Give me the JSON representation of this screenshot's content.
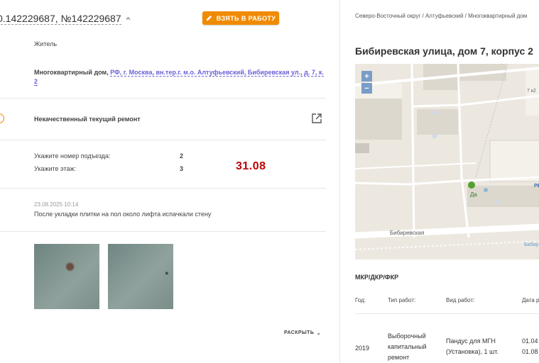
{
  "header": {
    "title": "0.142229687, №142229687",
    "chevron": "⌃",
    "take_button": "ВЗЯТЬ В РАБОТУ",
    "pencil_icon": "pencil-icon"
  },
  "applicant": {
    "role": "Житель"
  },
  "address": {
    "prefix": "Многоквартирный дом,",
    "link": "РФ, г. Москва, вн.тер.г. м.о. Алтуфьевский, Бибиревская ул., д. 7, к.",
    "link2": "2"
  },
  "category": {
    "name": "Некачественный текущий ремонт"
  },
  "fields": [
    {
      "label": "Укажите номер подъезда:",
      "value": "2"
    },
    {
      "label": "Укажите этаж:",
      "value": "3"
    }
  ],
  "annotation": "31.08",
  "comment": {
    "date": "23.08.2025 10:14",
    "text": "После укладки плитки на пол около лифта испачкали стену"
  },
  "expand_label": "РАСКРЫТЬ",
  "right": {
    "breadcrumb": "Северо-Восточный округ / Алтуфьевский / Многоквартирный дом",
    "address_title": "Бибиревская улица, дом 7, корпус 2",
    "map": {
      "street": "Бибиревская",
      "street2": "Бибир",
      "building_label": "7 к2",
      "poi_label": "Да",
      "poi_label2": "PE",
      "zoom_in": "+",
      "zoom_out": "−"
    },
    "section_title": "МКР/ДКР/ФКР",
    "table": {
      "headers": [
        "Год:",
        "Тип работ:",
        "Вид работ:",
        "Дата р"
      ],
      "row": {
        "year": "2019",
        "type_line1": "Выборочный",
        "type_line2": "капитальный",
        "type_line3": "ремонт",
        "kind_line1": "Пандус для МГН",
        "kind_line2": "(Установка), 1 шт.",
        "date1": "01.04",
        "date2": "01.08"
      }
    }
  },
  "colors": {
    "accent": "#f08a00",
    "link": "#6a60d8",
    "annotation": "#c00000"
  }
}
